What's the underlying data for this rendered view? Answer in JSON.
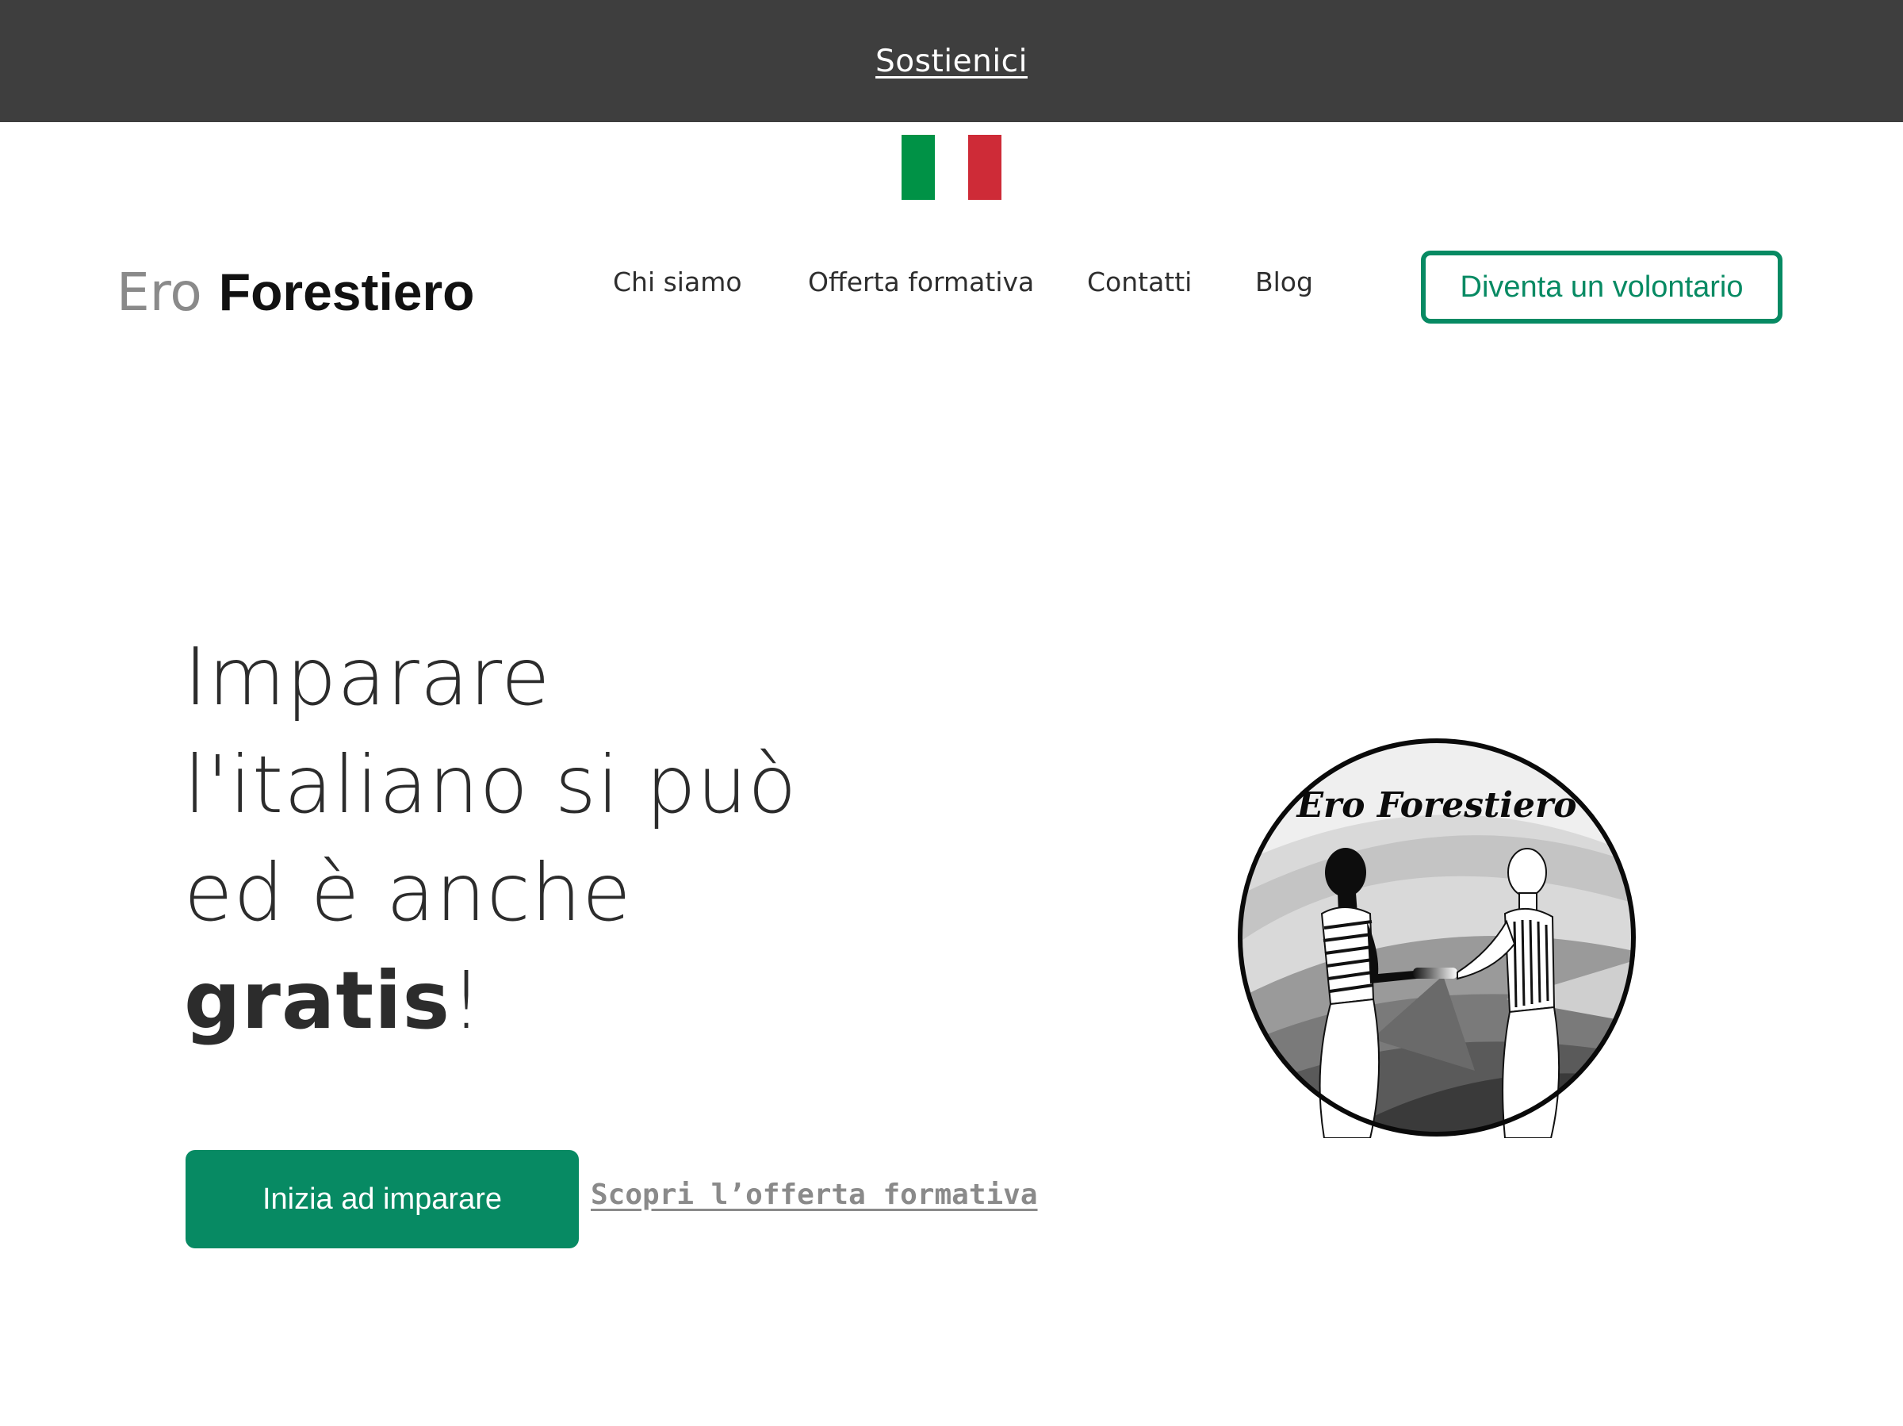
{
  "topbar": {
    "link_label": "Sostienici"
  },
  "language": {
    "flag_colors": [
      "#009246",
      "#ffffff",
      "#ce2b37"
    ],
    "icon": "italian-flag-icon"
  },
  "brand": {
    "logo_light": "Ero",
    "logo_bold": "Forestiero"
  },
  "nav": {
    "items": [
      {
        "label": "Chi siamo"
      },
      {
        "label": "Offerta formativa"
      },
      {
        "label": "Contatti"
      },
      {
        "label": "Blog"
      }
    ],
    "cta_label": "Diventa un volontario"
  },
  "hero": {
    "title_lines": [
      "Imparare",
      "l'italiano si può",
      "ed è anche"
    ],
    "title_bold": "gratis",
    "title_end": "!",
    "primary_button": "Inizia ad imparare",
    "secondary_link": "Scopri l’offerta formativa"
  },
  "emblem": {
    "text": "Ero Forestiero"
  },
  "colors": {
    "accent": "#078a63",
    "topbar": "#3e3e3e",
    "link_muted": "#8a8a8a"
  }
}
